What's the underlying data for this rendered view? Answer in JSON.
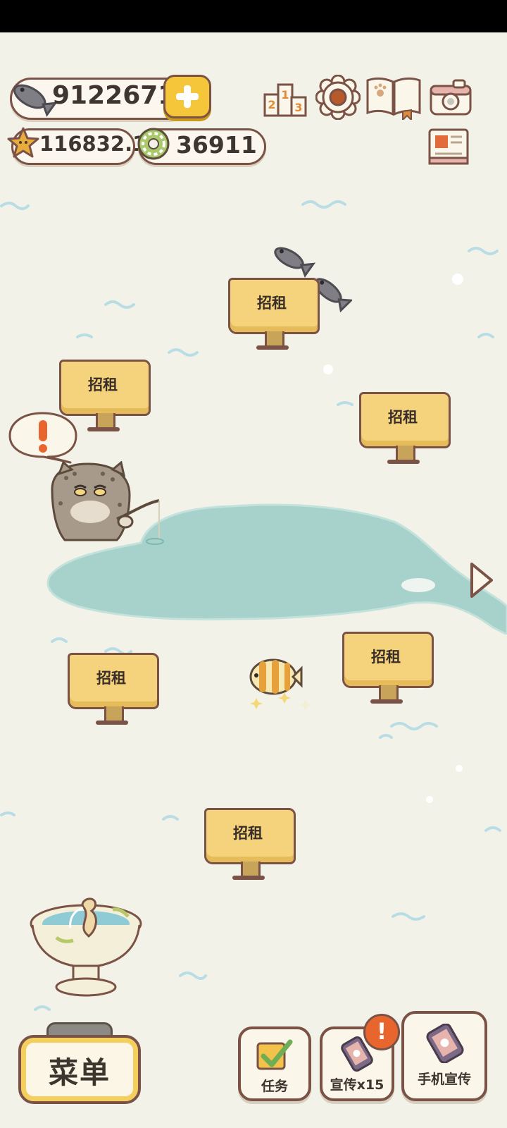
{
  "currencies": {
    "fish": "9122671",
    "stars": "116832.1",
    "coins": "36911"
  },
  "signs": [
    {
      "label": "招租"
    },
    {
      "label": "招租"
    },
    {
      "label": "招租"
    },
    {
      "label": "招租"
    },
    {
      "label": "招租"
    },
    {
      "label": "招租"
    }
  ],
  "bottom": {
    "menu_label": "菜单",
    "tasks_label": "任务",
    "promote_label": "宣传x15",
    "phone_promote_label": "手机宣传"
  },
  "icons": [
    "fish-icon",
    "plus-icon",
    "star-icon",
    "coin-icon",
    "ranking-icon",
    "settings-gear-icon",
    "book-icon",
    "camera-icon",
    "newspaper-icon",
    "alert-icon",
    "next-arrow-icon"
  ],
  "colors": {
    "background": "#f3f2e8",
    "lake": "#a7d2cb",
    "sign": "#f5d37c",
    "outline": "#7a5246",
    "accent_yellow": "#f6c63a",
    "alert": "#e8662e"
  }
}
